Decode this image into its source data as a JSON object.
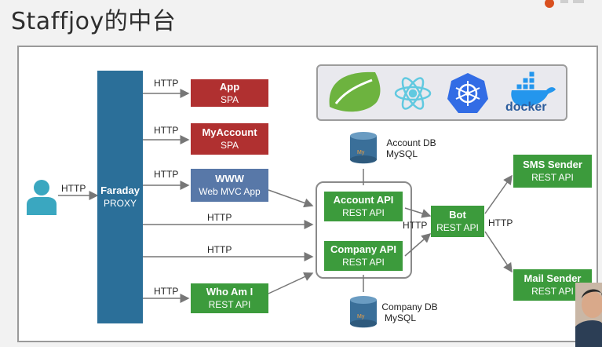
{
  "title": "Staffjoy的中台",
  "proxy": {
    "name": "Faraday",
    "sub": "PROXY"
  },
  "user_link": "HTTP",
  "frontends": [
    {
      "name": "App",
      "sub": "SPA",
      "link": "HTTP"
    },
    {
      "name": "MyAccount",
      "sub": "SPA",
      "link": "HTTP"
    },
    {
      "name": "WWW",
      "sub": "Web MVC App",
      "link": "HTTP"
    }
  ],
  "direct_links": [
    "HTTP",
    "HTTP"
  ],
  "whoami": {
    "name": "Who Am I",
    "sub": "REST API",
    "link": "HTTP"
  },
  "account_api": {
    "name": "Account API",
    "sub": "REST API"
  },
  "company_api": {
    "name": "Company API",
    "sub": "REST API"
  },
  "account_db": {
    "name": "Account DB",
    "sub": "MySQL"
  },
  "company_db": {
    "name": "Company DB",
    "sub": "MySQL"
  },
  "bot": {
    "name": "Bot",
    "sub": "REST API",
    "link_in": "HTTP",
    "link_out": "HTTP"
  },
  "sms": {
    "name": "SMS Sender",
    "sub": "REST API"
  },
  "mail": {
    "name": "Mail Sender",
    "sub": "REST API"
  },
  "logos": {
    "spring": "spring-leaf-icon",
    "react": "react-atom-icon",
    "kubernetes": "kubernetes-wheel-icon",
    "docker": "docker-whale-icon",
    "docker_text": "docker"
  },
  "colors": {
    "proxy": "#2b6f99",
    "frontend_red": "#b03030",
    "www_blue": "#5878a8",
    "service_green": "#3c9b3c",
    "user_teal": "#3aa7c0"
  }
}
